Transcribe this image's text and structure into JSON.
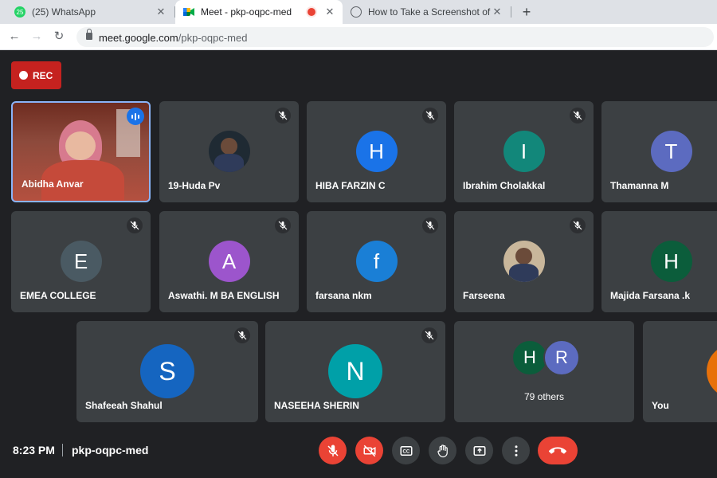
{
  "browser": {
    "tabs": [
      {
        "title": "(25) WhatsApp",
        "favicon": "whatsapp-icon",
        "badge": "25"
      },
      {
        "title": "Meet - pkp-oqpc-med",
        "favicon": "meet-icon"
      },
      {
        "title": "How to Take a Screenshot of a Go",
        "favicon": "globe-icon"
      }
    ],
    "url_host": "meet.google.com",
    "url_path": "/pkp-oqpc-med"
  },
  "meet": {
    "rec_label": "REC",
    "participants": [
      {
        "name": "Abidha Anvar",
        "initial": "",
        "color": "#8d4a3c"
      },
      {
        "name": "19-Huda Pv",
        "initial": "",
        "color": "#1f2a33"
      },
      {
        "name": "HIBA FARZIN C",
        "initial": "H",
        "color": "#1a73e8"
      },
      {
        "name": "Ibrahim Cholakkal",
        "initial": "I",
        "color": "#12877a"
      },
      {
        "name": "Thamanna M",
        "initial": "T",
        "color": "#5c6bc0"
      },
      {
        "name": "EMEA COLLEGE",
        "initial": "E",
        "color": "#4a5a63"
      },
      {
        "name": "Aswathi. M BA ENGLISH",
        "initial": "A",
        "color": "#9c55cc"
      },
      {
        "name": "farsana nkm",
        "initial": "f",
        "color": "#1a7fd6"
      },
      {
        "name": "Farseena",
        "initial": "",
        "color": "#c9b79b"
      },
      {
        "name": "Majida Farsana .k",
        "initial": "H",
        "color": "#0b5d3b"
      },
      {
        "name": "Shafeeah Shahul",
        "initial": "S",
        "color": "#1565c0"
      },
      {
        "name": "NASEEHA SHERIN",
        "initial": "N",
        "color": "#00a0a8"
      }
    ],
    "others": {
      "initials": [
        "H",
        "R"
      ],
      "colors": [
        "#0b5d3b",
        "#5c6bc0"
      ],
      "label": "79 others"
    },
    "self_label": "You",
    "self_color": "#e8710a",
    "time": "8:23 PM",
    "meeting_code": "pkp-oqpc-med",
    "controls": [
      "mic-off-icon",
      "camera-off-icon",
      "captions-icon",
      "raise-hand-icon",
      "present-icon",
      "more-icon",
      "hang-up-icon"
    ]
  }
}
